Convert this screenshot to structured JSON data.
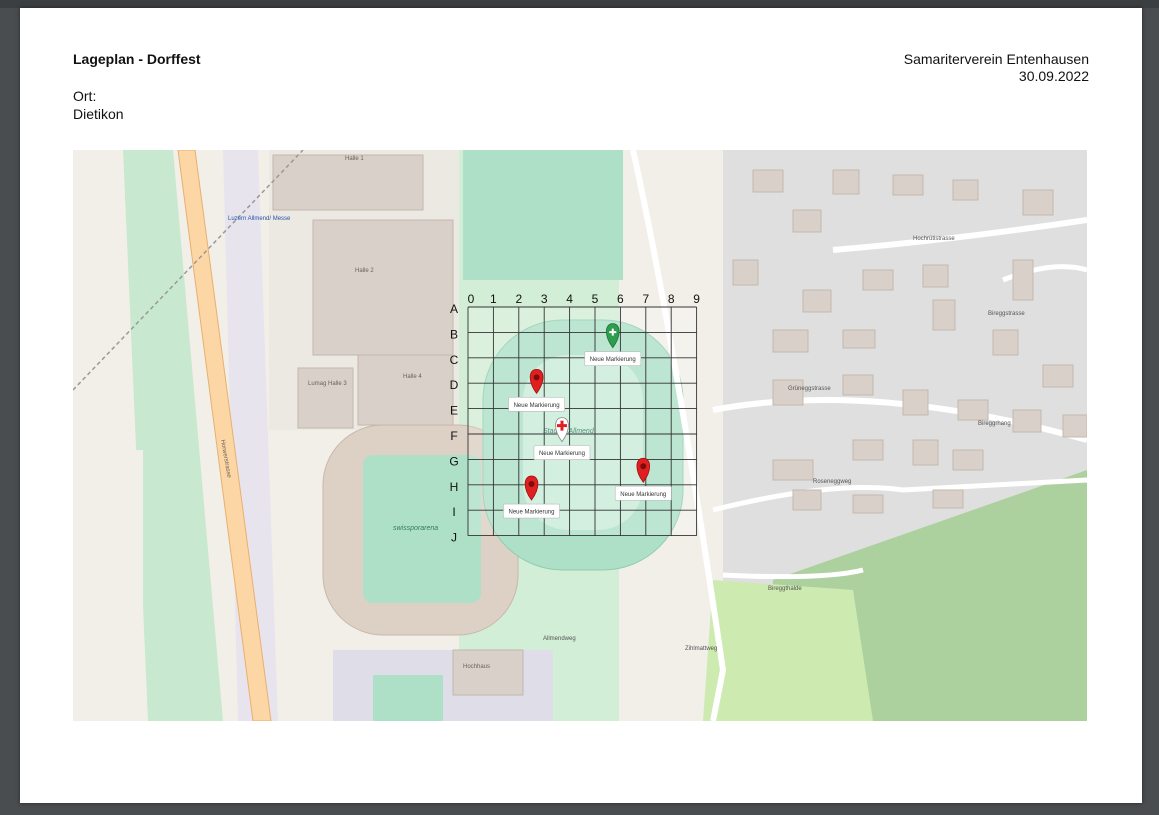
{
  "header": {
    "title": "Lageplan - Dorffest",
    "organization": "Samariterverein Entenhausen",
    "date": "30.09.2022",
    "location_label": "Ort:",
    "location_value": "Dietikon"
  },
  "grid": {
    "columns": [
      "0",
      "1",
      "2",
      "3",
      "4",
      "5",
      "6",
      "7",
      "8",
      "9"
    ],
    "rows": [
      "A",
      "B",
      "C",
      "D",
      "E",
      "F",
      "G",
      "H",
      "I",
      "J"
    ]
  },
  "markers": [
    {
      "type": "green-aid",
      "label": "Neue Markierung",
      "col": 5.7,
      "row": 1.6
    },
    {
      "type": "red-pin",
      "label": "Neue Markierung",
      "col": 2.7,
      "row": 3.4
    },
    {
      "type": "white-cross",
      "label": "Neue Markierung",
      "col": 3.7,
      "row": 5.3
    },
    {
      "type": "red-pin",
      "label": "Neue Markierung",
      "col": 6.9,
      "row": 6.9
    },
    {
      "type": "red-pin",
      "label": "Neue Markierung",
      "col": 2.5,
      "row": 7.6
    }
  ],
  "map_labels": {
    "halle1": "Halle 1",
    "halle2": "Halle 2",
    "halle3": "Lumag Halle 3",
    "halle4": "Halle 4",
    "station": "Luzern Allmend/ Messe",
    "horwerstrasse": "Horwerstrasse",
    "stadion": "Stadion Allmend",
    "swissporarena": "swissporarena",
    "hochrutistrasse": "Hochrütistrasse",
    "grunegg": "Grüneggstrasse",
    "rosenegg": "Roseneggweg",
    "biregghang": "Bireggrhang",
    "bireggstrasse": "Bireggstrasse",
    "bireggthalde": "Bireggthalde",
    "zihlmattweg": "Zihlmattweg",
    "allmendweg": "Allmendweg",
    "hochhaus": "Hochhaus"
  },
  "colors": {
    "pitch_green": "#aee0c8",
    "park_green": "#cdebd2",
    "wood_green": "#add19e",
    "road_orange": "#fcd6a4",
    "building": "#d9d0c9",
    "marker_red": "#e02020",
    "marker_green": "#2e9e4e"
  }
}
